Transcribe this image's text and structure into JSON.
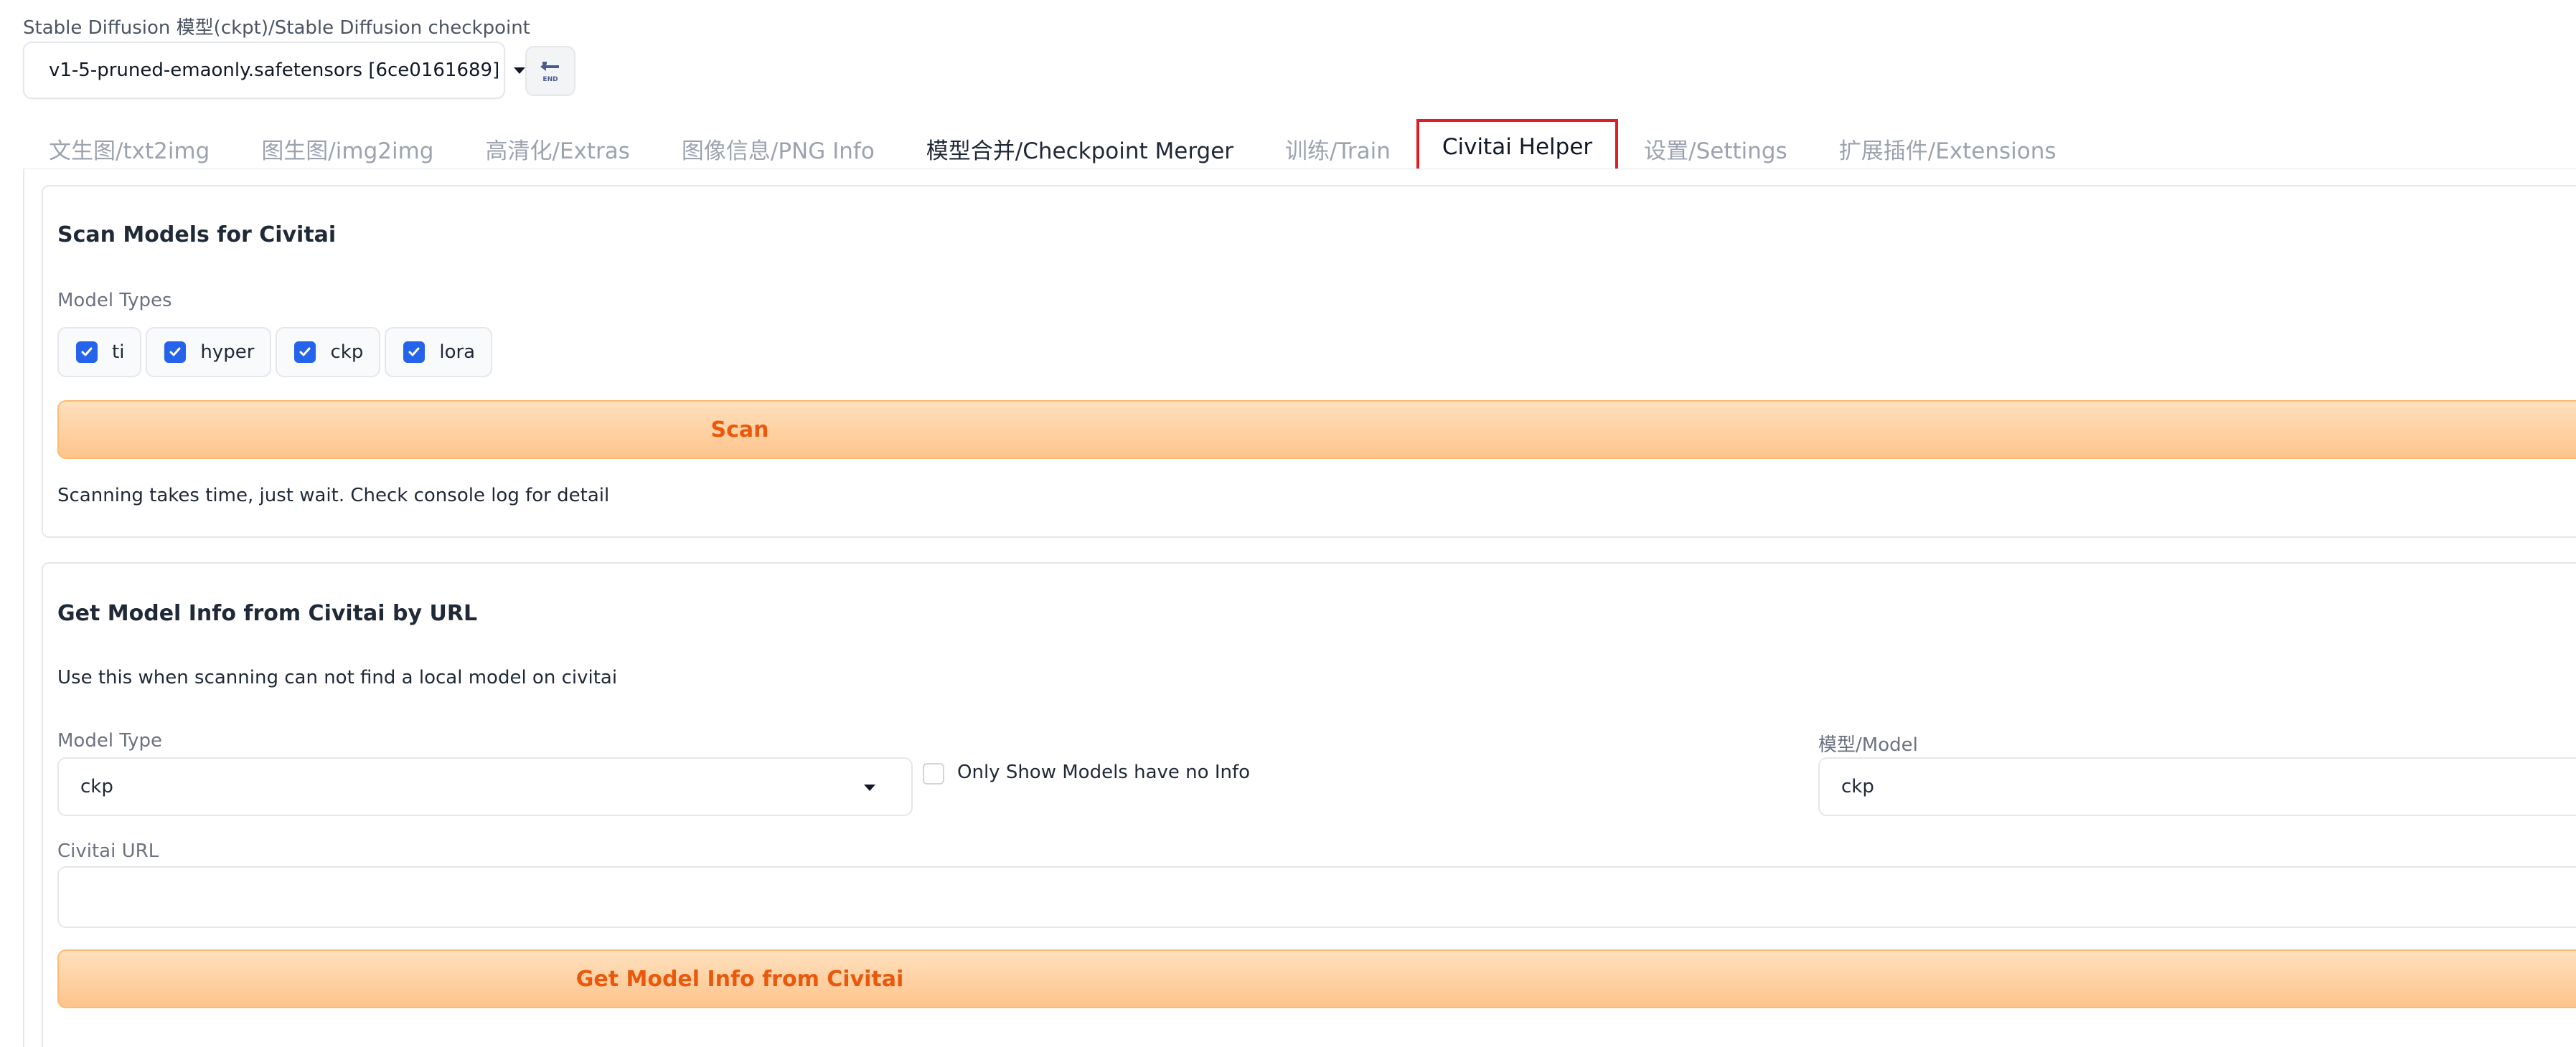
{
  "checkpoint": {
    "label": "Stable Diffusion 模型(ckpt)/Stable Diffusion checkpoint",
    "selected": "v1-5-pruned-emaonly.safetensors [6ce0161689]",
    "refresh_icon_text": "END"
  },
  "tabs": [
    {
      "label": "文生图/txt2img"
    },
    {
      "label": "图生图/img2img"
    },
    {
      "label": "高清化/Extras"
    },
    {
      "label": "图像信息/PNG Info"
    },
    {
      "label": "模型合并/Checkpoint Merger"
    },
    {
      "label": "训练/Train"
    },
    {
      "label": "Civitai Helper"
    },
    {
      "label": "设置/Settings"
    },
    {
      "label": "扩展插件/Extensions"
    }
  ],
  "scan_section": {
    "title": "Scan Models for Civitai",
    "model_types_label": "Model Types",
    "model_types": [
      {
        "label": "ti",
        "checked": true
      },
      {
        "label": "hyper",
        "checked": true
      },
      {
        "label": "ckp",
        "checked": true
      },
      {
        "label": "lora",
        "checked": true
      }
    ],
    "scan_button": "Scan",
    "note": "Scanning takes time, just wait. Check console log for detail"
  },
  "get_info_section": {
    "title": "Get Model Info from Civitai by URL",
    "note": "Use this when scanning can not find a local model on civitai",
    "model_type_label": "Model Type",
    "model_type_value": "ckp",
    "only_show_label": "Only Show Models have no Info",
    "model_label": "模型/Model",
    "model_value": "ckp",
    "url_label": "Civitai URL",
    "url_value": "",
    "get_button": "Get Model Info from Civitai"
  },
  "colors": {
    "accent_orange": "#ea580c",
    "checkbox_blue": "#2563eb",
    "selected_tab_border": "#e11d24"
  }
}
